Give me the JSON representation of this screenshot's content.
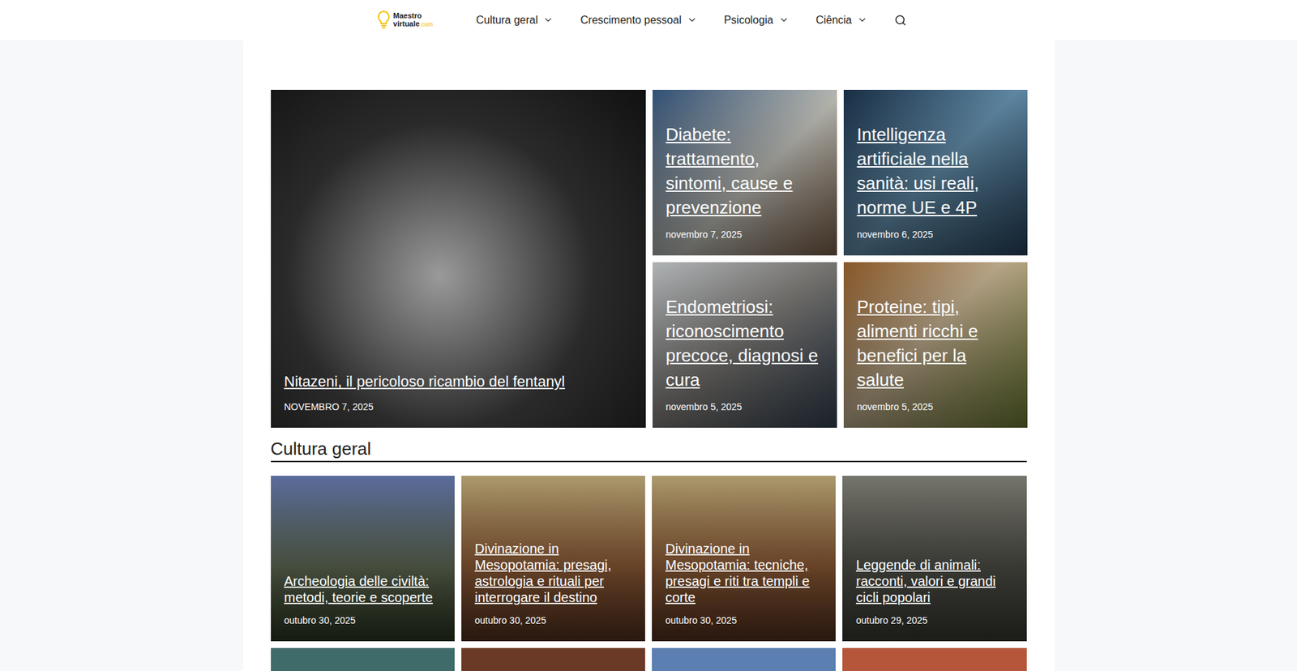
{
  "header": {
    "logo": {
      "line1": "Maestro",
      "line2": "virtuale",
      "suffix": ".com"
    },
    "nav": [
      {
        "label": "Cultura geral",
        "has_dropdown": true
      },
      {
        "label": "Crescimento pessoal",
        "has_dropdown": true
      },
      {
        "label": "Psicologia",
        "has_dropdown": true
      },
      {
        "label": "Ciência",
        "has_dropdown": true
      }
    ]
  },
  "featured": {
    "main": {
      "title": "Nitazeni, il pericoloso ricambio del fentanyl",
      "date": "NOVEMBRO 7, 2025"
    },
    "side": [
      {
        "title": "Diabete: trattamento, sintomi, cause e prevenzione",
        "date": "novembro 7, 2025"
      },
      {
        "title": "Intelligenza artificiale nella sanità: usi reali, norme UE e 4P",
        "date": "novembro 6, 2025"
      },
      {
        "title": "Endometriosi: riconoscimento precoce, diagnosi e cura",
        "date": "novembro 5, 2025"
      },
      {
        "title": "Proteine: tipi, alimenti ricchi e benefici per la salute",
        "date": "novembro 5, 2025"
      }
    ]
  },
  "section": {
    "title": "Cultura geral",
    "cards": [
      {
        "title": "Archeologia delle civiltà: metodi, teorie e scoperte",
        "date": "outubro 30, 2025"
      },
      {
        "title": "Divinazione in Mesopotamia: presagi, astrologia e rituali per interrogare il destino",
        "date": "outubro 30, 2025"
      },
      {
        "title": "Divinazione in Mesopotamia: tecniche, presagi e riti tra templi e corte",
        "date": "outubro 30, 2025"
      },
      {
        "title": "Leggende di animali: racconti, valori e grandi cicli popolari",
        "date": "outubro 29, 2025"
      }
    ],
    "partial_cards": [
      {
        "visible": true
      },
      {
        "visible": true
      },
      {
        "visible": true
      },
      {
        "visible": true
      }
    ]
  }
}
